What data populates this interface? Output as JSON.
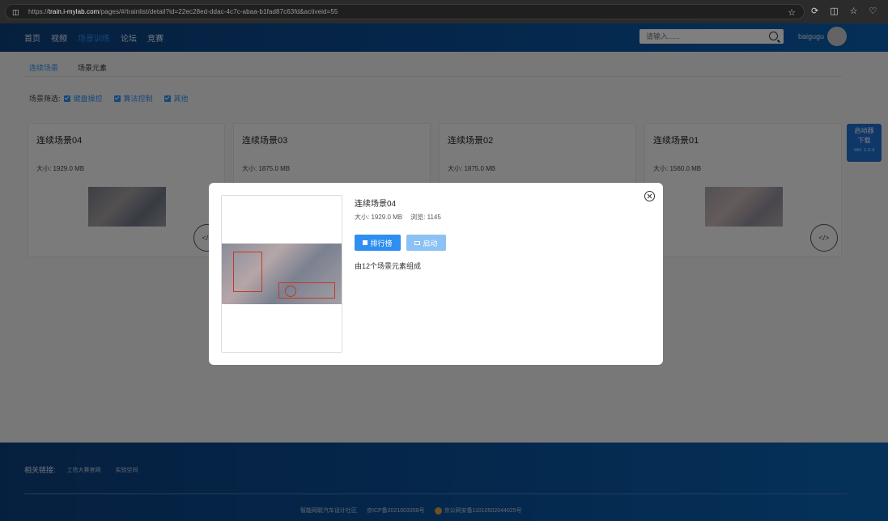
{
  "browser": {
    "url_prefix": "https://",
    "url_domain": "train.i-mylab.com",
    "url_rest": "/pages/#/trainlist/detail?id=22ec28ed-ddac-4c7c-abaa-b1fad87c63fd&activeid=55"
  },
  "header": {
    "nav": [
      "首页",
      "视频",
      "场景训练",
      "论坛",
      "竞赛"
    ],
    "active_nav_index": 2,
    "search_placeholder": "请输入......",
    "username": "baigugu"
  },
  "tabs": [
    "连续场景",
    "场景元素"
  ],
  "filter": {
    "label": "场景筛选:",
    "options": [
      "键盘操控",
      "算法控制",
      "其他"
    ]
  },
  "cards": [
    {
      "title": "连续场景04",
      "size": "大小:  1929.0 MB"
    },
    {
      "title": "连续场景03",
      "size": "大小:  1875.0 MB"
    },
    {
      "title": "连续场景02",
      "size": "大小:  1875.0 MB"
    },
    {
      "title": "连续场景01",
      "size": "大小:  1560.0 MB"
    }
  ],
  "side_widget": {
    "line1": "启动器",
    "line2": "下载",
    "version": "Ver: 1.0.3"
  },
  "modal": {
    "title": "连续场景04",
    "size": "大小:  1929.0 MB",
    "views": "浏览:  1145",
    "rank_button": "排行榜",
    "start_button": "启动",
    "description": "由12个场景元素组成"
  },
  "footer": {
    "links_label": "相关链接:",
    "links": [
      "工信大赛官网",
      "实验空间"
    ],
    "site_name": "智能网联汽车设计社区",
    "icp": "京ICP备2021003358号",
    "police": "京公网安备11010502044025号"
  }
}
